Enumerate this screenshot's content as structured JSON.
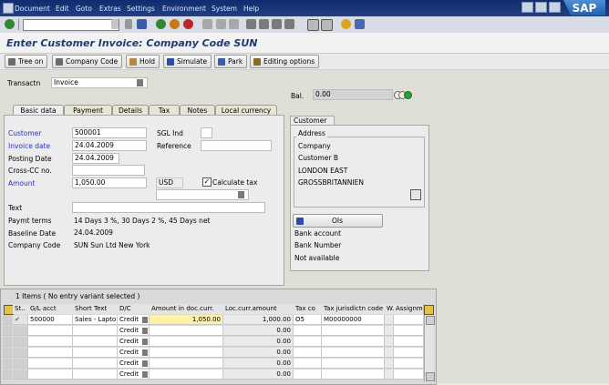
{
  "menu": [
    "Document",
    "Edit",
    "Goto",
    "Extras",
    "Settings",
    "Environment",
    "System",
    "Help"
  ],
  "logo": "SAP",
  "title": "Enter Customer Invoice: Company Code SUN",
  "app_toolbar": {
    "tree_on": "Tree on",
    "company_code": "Company Code",
    "hold": "Hold",
    "simulate": "Simulate",
    "park": "Park",
    "editing_options": "Editing options"
  },
  "transaction": {
    "label": "Transactn",
    "value": "Invoice"
  },
  "balance": {
    "label": "Bal.",
    "value": "0.00"
  },
  "tabs": [
    "Basic data",
    "Payment",
    "Details",
    "Tax",
    "Notes",
    "Local currency"
  ],
  "form": {
    "customer": {
      "label": "Customer",
      "value": "500001"
    },
    "sgl_ind": {
      "label": "SGL Ind",
      "value": ""
    },
    "invoice_date": {
      "label": "Invoice date",
      "value": "24.04.2009"
    },
    "reference": {
      "label": "Reference",
      "value": ""
    },
    "posting_date": {
      "label": "Posting Date",
      "value": "24.04.2009"
    },
    "cross_cc": {
      "label": "Cross-CC no.",
      "value": ""
    },
    "amount": {
      "label": "Amount",
      "value": "1,050.00",
      "currency": "USD"
    },
    "calc_tax": {
      "label": "Calculate tax",
      "checked": true
    },
    "text": {
      "label": "Text",
      "value": ""
    },
    "paymt_terms": {
      "label": "Paymt terms",
      "value": "14 Days 3 %, 30 Days 2 %, 45 Days net"
    },
    "baseline_date": {
      "label": "Baseline Date",
      "value": "24.04.2009"
    },
    "company_code": {
      "label": "Company Code",
      "value": "SUN Sun Ltd New York"
    }
  },
  "customer_panel": {
    "tab": "Customer",
    "address_title": "Address",
    "address_lines": [
      "Company",
      "Customer B",
      "LONDON EAST",
      "GROSSBRITANNIEN"
    ],
    "ois_button": "OIs",
    "bank_account": "Bank account",
    "bank_number": "Bank Number",
    "not_available": "Not available"
  },
  "grid": {
    "status": "1 Items ( No entry variant selected )",
    "headers": [
      "St..",
      "G/L acct",
      "Short Text",
      "D/C",
      "Amount in doc.curr.",
      "Loc.curr.amount",
      "Tax co",
      "Tax jurisdictn code",
      "W..",
      "Assignm"
    ],
    "rows": [
      {
        "gl": "500000",
        "short": "Sales - Lapto",
        "dc": "Credit",
        "amount": "1,050.00",
        "loc": "1,000.00",
        "tax": "O5",
        "jur": "M00000000",
        "check": true
      },
      {
        "gl": "",
        "short": "",
        "dc": "Credit",
        "amount": "",
        "loc": "0.00",
        "tax": "",
        "jur": "",
        "check": false
      },
      {
        "gl": "",
        "short": "",
        "dc": "Credit",
        "amount": "",
        "loc": "0.00",
        "tax": "",
        "jur": "",
        "check": false
      },
      {
        "gl": "",
        "short": "",
        "dc": "Credit",
        "amount": "",
        "loc": "0.00",
        "tax": "",
        "jur": "",
        "check": false
      },
      {
        "gl": "",
        "short": "",
        "dc": "Credit",
        "amount": "",
        "loc": "0.00",
        "tax": "",
        "jur": "",
        "check": false
      },
      {
        "gl": "",
        "short": "",
        "dc": "Credit",
        "amount": "",
        "loc": "0.00",
        "tax": "",
        "jur": "",
        "check": false
      }
    ]
  }
}
